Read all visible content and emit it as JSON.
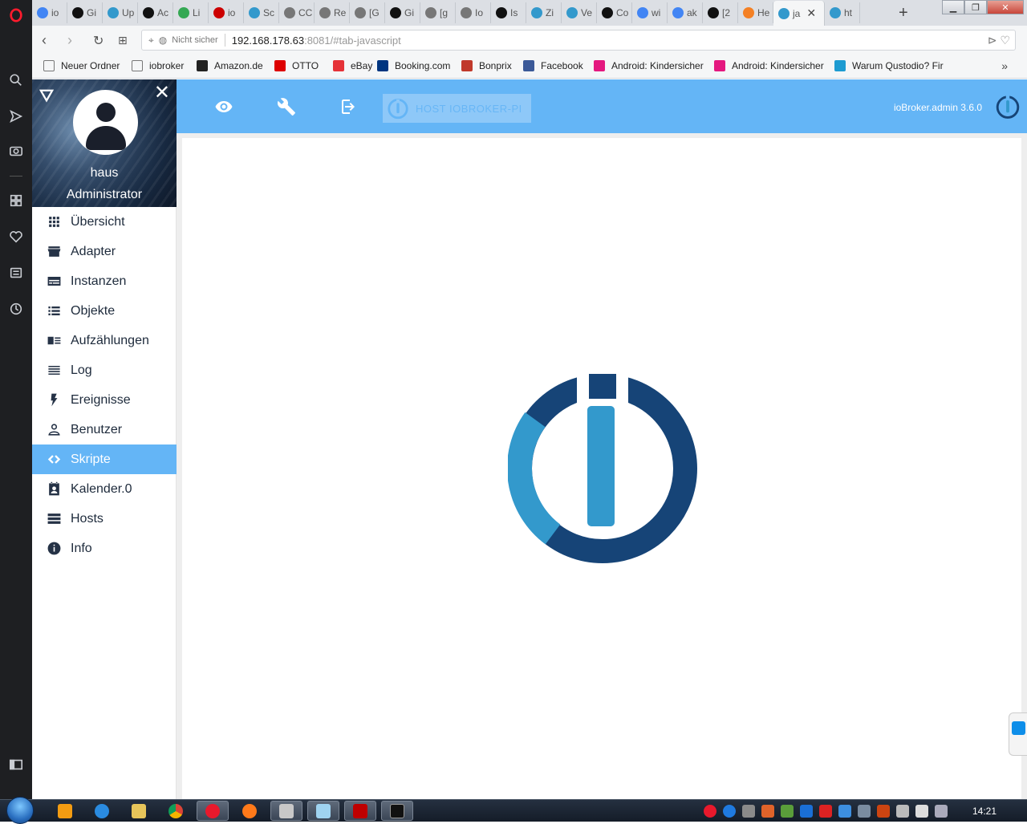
{
  "browser": {
    "tabs": [
      {
        "label": "io",
        "icon": "google-icon",
        "color": "#4285f4"
      },
      {
        "label": "Gi",
        "icon": "github-icon",
        "color": "#111111"
      },
      {
        "label": "Up",
        "icon": "iobroker-icon",
        "color": "#3399cc"
      },
      {
        "label": "Ac",
        "icon": "github-icon",
        "color": "#111111"
      },
      {
        "label": "Li",
        "icon": "google-icon",
        "color": "#34a853"
      },
      {
        "label": "io",
        "icon": "iobroker-red-icon",
        "color": "#cc0000"
      },
      {
        "label": "Sc",
        "icon": "iobroker-icon",
        "color": "#3399cc"
      },
      {
        "label": "CC",
        "icon": "page-icon",
        "color": "#777777"
      },
      {
        "label": "Re",
        "icon": "page-icon",
        "color": "#777777"
      },
      {
        "label": "[G",
        "icon": "page-icon",
        "color": "#777777"
      },
      {
        "label": "Gi",
        "icon": "github-icon",
        "color": "#111111"
      },
      {
        "label": "[g",
        "icon": "page-icon",
        "color": "#777777"
      },
      {
        "label": "Io",
        "icon": "page-icon",
        "color": "#777777"
      },
      {
        "label": "Is",
        "icon": "github-icon",
        "color": "#111111"
      },
      {
        "label": "Zi",
        "icon": "iobroker-icon",
        "color": "#3399cc"
      },
      {
        "label": "Ve",
        "icon": "iobroker-icon",
        "color": "#3399cc"
      },
      {
        "label": "Co",
        "icon": "github-icon",
        "color": "#111111"
      },
      {
        "label": "wi",
        "icon": "google-icon",
        "color": "#4285f4"
      },
      {
        "label": "ak",
        "icon": "google-icon",
        "color": "#4285f4"
      },
      {
        "label": "[2",
        "icon": "github-icon",
        "color": "#111111"
      },
      {
        "label": "He",
        "icon": "stackoverflow-icon",
        "color": "#f48024"
      },
      {
        "label": "ja",
        "icon": "iobroker-icon",
        "color": "#3399cc",
        "active": true
      },
      {
        "label": "ht",
        "icon": "iobroker-icon",
        "color": "#3399cc"
      }
    ],
    "url": {
      "security_label": "Nicht sicher",
      "host": "192.168.178.63",
      "rest": ":8081/#tab-javascript"
    },
    "bookmarks": [
      {
        "label": "Neuer Ordner",
        "icon": "folder-icon"
      },
      {
        "label": "iobroker",
        "icon": "folder-icon"
      },
      {
        "label": "Amazon.de",
        "icon": "amazon-icon"
      },
      {
        "label": "OTTO",
        "icon": "otto-icon"
      },
      {
        "label": "eBay",
        "icon": "ebay-icon"
      },
      {
        "label": "Booking.com",
        "icon": "booking-icon"
      },
      {
        "label": "Bonprix",
        "icon": "bonprix-icon"
      },
      {
        "label": "Facebook",
        "icon": "facebook-icon"
      },
      {
        "label": "Android: Kindersicher",
        "icon": "android-icon"
      },
      {
        "label": "Android: Kindersicher",
        "icon": "android-icon"
      },
      {
        "label": "Warum Qustodio? Fir",
        "icon": "qustodio-icon"
      }
    ]
  },
  "drawer": {
    "user_name": "haus",
    "user_role": "Administrator",
    "items": [
      {
        "label": "Übersicht",
        "icon": "apps-grid-icon"
      },
      {
        "label": "Adapter",
        "icon": "store-icon"
      },
      {
        "label": "Instanzen",
        "icon": "instances-icon"
      },
      {
        "label": "Objekte",
        "icon": "list-icon"
      },
      {
        "label": "Aufzählungen",
        "icon": "enum-card-icon"
      },
      {
        "label": "Log",
        "icon": "log-lines-icon"
      },
      {
        "label": "Ereignisse",
        "icon": "flash-icon"
      },
      {
        "label": "Benutzer",
        "icon": "person-icon"
      },
      {
        "label": "Skripte",
        "icon": "code-icon",
        "active": true
      },
      {
        "label": "Kalender.0",
        "icon": "calendar-person-icon"
      },
      {
        "label": "Hosts",
        "icon": "hosts-icon"
      },
      {
        "label": "Info",
        "icon": "info-icon"
      }
    ]
  },
  "appbar": {
    "host_label": "HOST IOBROKER-PI",
    "version": "ioBroker.admin 3.6.0"
  },
  "taskbar": {
    "clock": "14:21"
  },
  "colors": {
    "accent": "#64b5f6",
    "logo_dark": "#164477",
    "logo_light": "#3399cc"
  }
}
